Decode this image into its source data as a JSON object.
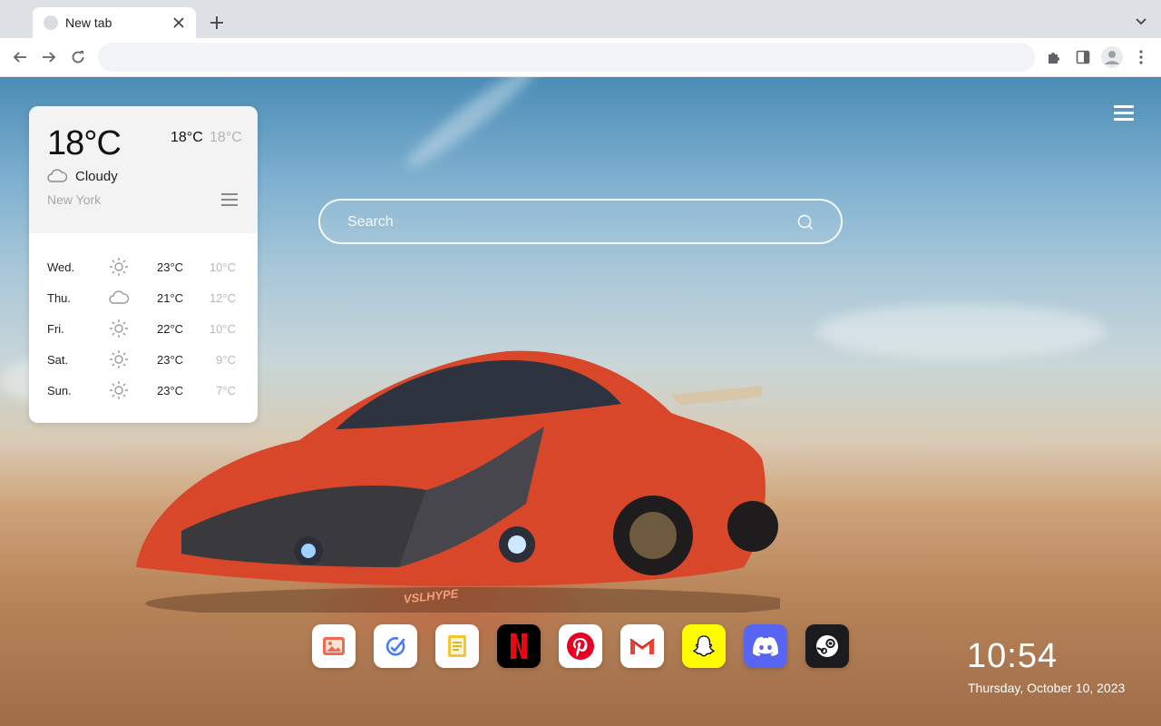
{
  "browser": {
    "tab_title": "New tab",
    "address_value": "",
    "icons": [
      "tab-favicon-icon",
      "close-icon",
      "plus-icon",
      "chevron-down-icon",
      "back-arrow-icon",
      "forward-arrow-icon",
      "reload-icon",
      "puzzle-icon",
      "side-panel-icon",
      "profile-avatar-icon",
      "more-vertical-icon"
    ]
  },
  "weather": {
    "current_temp": "18°C",
    "high": "18°C",
    "low": "18°C",
    "condition": "Cloudy",
    "condition_icon": "cloud-icon",
    "city": "New York",
    "forecast": [
      {
        "day": "Wed.",
        "icon": "sun-icon",
        "high": "23°C",
        "low": "10°C"
      },
      {
        "day": "Thu.",
        "icon": "cloud-icon",
        "high": "21°C",
        "low": "12°C"
      },
      {
        "day": "Fri.",
        "icon": "sun-icon",
        "high": "22°C",
        "low": "10°C"
      },
      {
        "day": "Sat.",
        "icon": "sun-icon",
        "high": "23°C",
        "low": "9°C"
      },
      {
        "day": "Sun.",
        "icon": "sun-icon",
        "high": "23°C",
        "low": "7°C"
      }
    ]
  },
  "search": {
    "placeholder": "Search"
  },
  "car_badge": "VSLHYPE",
  "dock": [
    {
      "name": "photos",
      "icon": "image-icon",
      "bg": "#ffffff"
    },
    {
      "name": "notes",
      "icon": "pen-check-icon",
      "bg": "#ffffff"
    },
    {
      "name": "docs",
      "icon": "document-icon",
      "bg": "#ffffff"
    },
    {
      "name": "netflix",
      "icon": "netflix-icon",
      "bg": "#000000"
    },
    {
      "name": "pinterest",
      "icon": "pinterest-icon",
      "bg": "#ffffff"
    },
    {
      "name": "gmail",
      "icon": "gmail-icon",
      "bg": "#ffffff"
    },
    {
      "name": "snapchat",
      "icon": "snapchat-icon",
      "bg": "#fffc00"
    },
    {
      "name": "discord",
      "icon": "discord-icon",
      "bg": "#5865f2"
    },
    {
      "name": "steam",
      "icon": "steam-icon",
      "bg": "#1b1b1f"
    }
  ],
  "clock": {
    "time": "10:54",
    "date": "Thursday, October 10, 2023"
  }
}
